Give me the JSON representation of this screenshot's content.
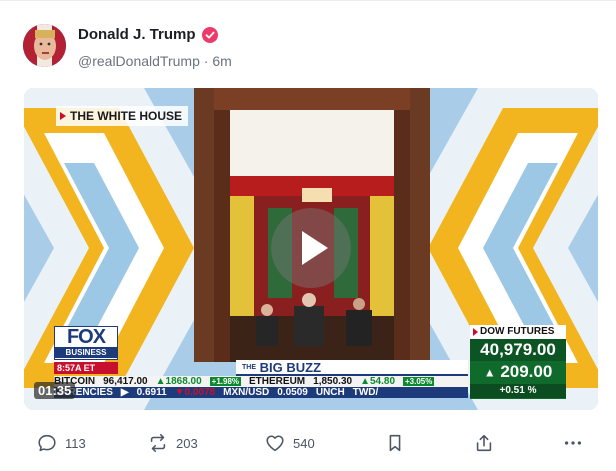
{
  "post": {
    "author_name": "Donald J. Trump",
    "handle": "@realDonaldTrump",
    "separator": "·",
    "time_ago": "6m"
  },
  "video": {
    "location_label": "THE WHITE HOUSE",
    "duration": "01:35",
    "network_top": "FOX",
    "network_bottom": "BUSINESS",
    "timestamp": "8:57A ET",
    "show_prefix": "THE",
    "show_name": "BIG BUZZ",
    "ticker_row1": [
      {
        "text": "BITCOIN",
        "cls": ""
      },
      {
        "text": "96,417.00",
        "cls": ""
      },
      {
        "text": "▲1868.00",
        "cls": "up"
      },
      {
        "text": "+1.98%",
        "cls": "chip-up"
      },
      {
        "text": "ETHEREUM",
        "cls": ""
      },
      {
        "text": "1,850.30",
        "cls": ""
      },
      {
        "text": "▲54.80",
        "cls": "up"
      },
      {
        "text": "+3.05%",
        "cls": "chip-up"
      }
    ],
    "ticker_row2": [
      {
        "text": "URRENCIES",
        "cls": ""
      },
      {
        "text": "▶",
        "cls": ""
      },
      {
        "text": "0.6911",
        "cls": ""
      },
      {
        "text": "▼0.0078",
        "cls": "down"
      },
      {
        "text": "MXN/USD",
        "cls": ""
      },
      {
        "text": "0.0509",
        "cls": ""
      },
      {
        "text": "UNCH",
        "cls": ""
      },
      {
        "text": "TWD/",
        "cls": ""
      }
    ],
    "dow_title": "DOW FUTURES",
    "dow_value": "40,979.00",
    "dow_change": "209.00",
    "dow_change_arrow": "▲",
    "dow_pct": "+0.51 %"
  },
  "actions": {
    "replies": "113",
    "reposts": "203",
    "likes": "540"
  },
  "colors": {
    "verified": "#ee3a6a",
    "fox_blue": "#1d3b7a",
    "dow_green": "#0f6a2c"
  }
}
